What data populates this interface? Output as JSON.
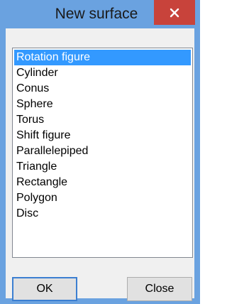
{
  "window": {
    "title": "New surface"
  },
  "list": {
    "items": [
      "Rotation figure",
      "Cylinder",
      "Conus",
      "Sphere",
      "Torus",
      "Shift figure",
      "Parallelepiped",
      "Triangle",
      "Rectangle",
      "Polygon",
      "Disc"
    ],
    "selected": "Rotation figure"
  },
  "buttons": {
    "ok_label": "OK",
    "close_label": "Close"
  },
  "icons": {
    "close": "close-icon"
  },
  "colors": {
    "titlebar": "#6aa2e0",
    "close_button": "#c8433b",
    "selection": "#3399ff",
    "client": "#f0f0f0"
  }
}
